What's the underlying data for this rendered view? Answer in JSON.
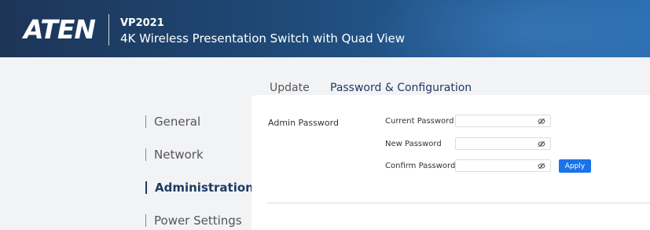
{
  "header": {
    "logo_text": "ATEN",
    "model": "VP2021",
    "product_name": "4K Wireless Presentation Switch with Quad View"
  },
  "tabs": [
    {
      "label": "Update",
      "active": false
    },
    {
      "label": "Password & Configuration",
      "active": true
    }
  ],
  "sidebar": {
    "items": [
      {
        "label": "General",
        "active": false
      },
      {
        "label": "Network",
        "active": false
      },
      {
        "label": "Administration",
        "active": true
      },
      {
        "label": "Power Settings",
        "active": false
      }
    ]
  },
  "admin_password": {
    "section_label": "Admin Password",
    "fields": [
      {
        "label": "Current Password",
        "value": ""
      },
      {
        "label": "New Password",
        "value": ""
      },
      {
        "label": "Confirm Password",
        "value": ""
      }
    ],
    "apply_label": "Apply"
  },
  "colors": {
    "header_start": "#1d3557",
    "header_end": "#2a6db0",
    "accent": "#1a73e8",
    "active_text": "#1f3b63"
  },
  "icons": {
    "eye": "eye-slash-icon"
  }
}
